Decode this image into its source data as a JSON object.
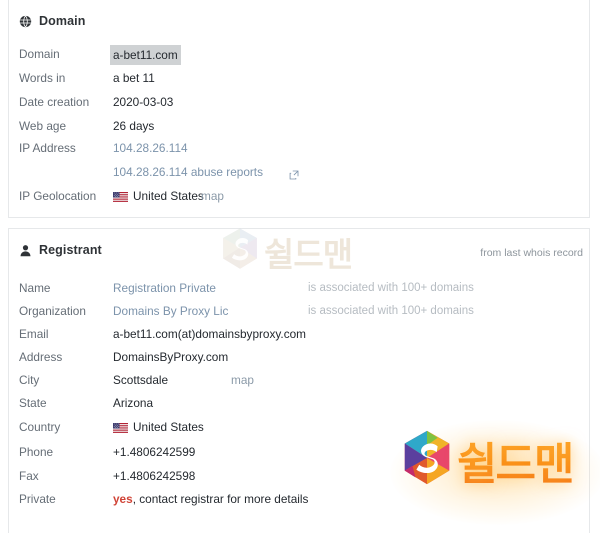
{
  "domain_section": {
    "title": "Domain",
    "icon": "globe-icon",
    "rows": [
      {
        "label": "Domain",
        "value": "a-bet11.com"
      },
      {
        "label": "Words in",
        "value": "a bet 11"
      },
      {
        "label": "Date creation",
        "value": "2020-03-03"
      },
      {
        "label": "Web age",
        "value": "26 days"
      },
      {
        "label": "IP Address",
        "value": "104.28.26.114"
      },
      {
        "label": "",
        "value": "104.28.26.114 abuse reports"
      },
      {
        "label": "IP Geolocation",
        "value": "United States",
        "map": "map"
      }
    ]
  },
  "registrant_section": {
    "title": "Registrant",
    "icon": "user-icon",
    "note": "from last whois record",
    "assoc_text": "is associated with 100+ domains",
    "rows": [
      {
        "label": "Name",
        "value": "Registration Private"
      },
      {
        "label": "Organization",
        "value": "Domains By Proxy Lic"
      },
      {
        "label": "Email",
        "value": "a-bet11.com(at)domainsbyproxy.com"
      },
      {
        "label": "Address",
        "value": "DomainsByProxy.com"
      },
      {
        "label": "City",
        "value": "Scottsdale",
        "map": "map"
      },
      {
        "label": "State",
        "value": "Arizona"
      },
      {
        "label": "Country",
        "value": "United States"
      },
      {
        "label": "Phone",
        "value": "+1.4806242599"
      },
      {
        "label": "Fax",
        "value": "+1.4806242598"
      },
      {
        "label": "Private",
        "value_strong": "yes",
        "value_rest": ", contact registrar for more details"
      }
    ]
  },
  "watermarks": {
    "pale_text": "쉴드맨",
    "bright_text": "쉴드맨"
  },
  "colors": {
    "link": "#7c93ab",
    "muted_link": "#8b9aa8",
    "label": "#656d76",
    "value": "#24292f",
    "accent_red": "#d04437",
    "highlight_bg": "#cfd2d4"
  }
}
